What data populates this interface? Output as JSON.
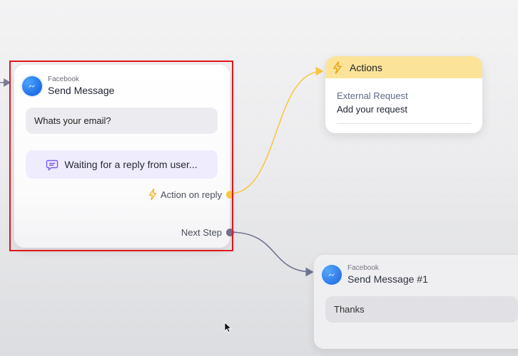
{
  "canvas": {
    "cursor": "arrow-cursor"
  },
  "node_send_message": {
    "platform": "Facebook",
    "title": "Send Message",
    "message_text": "Whats your email?",
    "waiting_text": "Waiting for a reply from user...",
    "action_on_reply_label": "Action on reply",
    "next_step_label": "Next Step"
  },
  "node_actions": {
    "title": "Actions",
    "request_type": "External Request",
    "request_hint": "Add your request"
  },
  "node_send_message_2": {
    "platform": "Facebook",
    "title": "Send Message #1",
    "message_text": "Thanks"
  },
  "colors": {
    "selection": "#e0161b",
    "reply_connector": "#f6c844",
    "next_connector": "#6e7390",
    "actions_header": "#fbe39a",
    "messenger_blue": "#1f6fe6",
    "waiting_bg": "#efecfd"
  },
  "icons": {
    "platform": "messenger-icon",
    "waiting": "chat-bubble-icon",
    "reply": "lightning-bolt-icon",
    "actions": "lightning-bolt-icon"
  }
}
